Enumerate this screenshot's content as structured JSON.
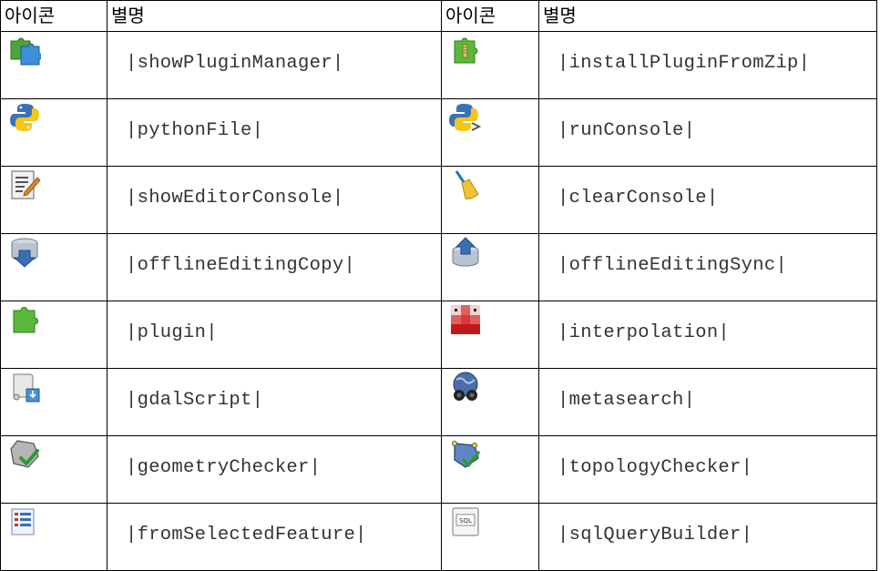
{
  "headers": {
    "icon": "아이콘",
    "alias": "별명"
  },
  "rows": [
    {
      "left": {
        "icon": "plugin-manager-icon",
        "alias": "|showPluginManager|"
      },
      "right": {
        "icon": "install-plugin-zip-icon",
        "alias": "|installPluginFromZip|"
      }
    },
    {
      "left": {
        "icon": "python-file-icon",
        "alias": "|pythonFile|"
      },
      "right": {
        "icon": "run-console-icon",
        "alias": "|runConsole|"
      }
    },
    {
      "left": {
        "icon": "editor-console-icon",
        "alias": "|showEditorConsole|"
      },
      "right": {
        "icon": "clear-console-broom-icon",
        "alias": "|clearConsole|"
      }
    },
    {
      "left": {
        "icon": "offline-editing-copy-icon",
        "alias": "|offlineEditingCopy|"
      },
      "right": {
        "icon": "offline-editing-sync-icon",
        "alias": "|offlineEditingSync|"
      }
    },
    {
      "left": {
        "icon": "plugin-puzzle-icon",
        "alias": "|plugin|"
      },
      "right": {
        "icon": "interpolation-icon",
        "alias": "|interpolation|"
      }
    },
    {
      "left": {
        "icon": "gdal-script-icon",
        "alias": "|gdalScript|"
      },
      "right": {
        "icon": "metasearch-globe-icon",
        "alias": "|metasearch|"
      }
    },
    {
      "left": {
        "icon": "geometry-checker-icon",
        "alias": "|geometryChecker|"
      },
      "right": {
        "icon": "topology-checker-icon",
        "alias": "|topologyChecker|"
      }
    },
    {
      "left": {
        "icon": "from-selected-feature-icon",
        "alias": "|fromSelectedFeature|"
      },
      "right": {
        "icon": "sql-query-builder-icon",
        "alias": "|sqlQueryBuilder|"
      }
    }
  ]
}
